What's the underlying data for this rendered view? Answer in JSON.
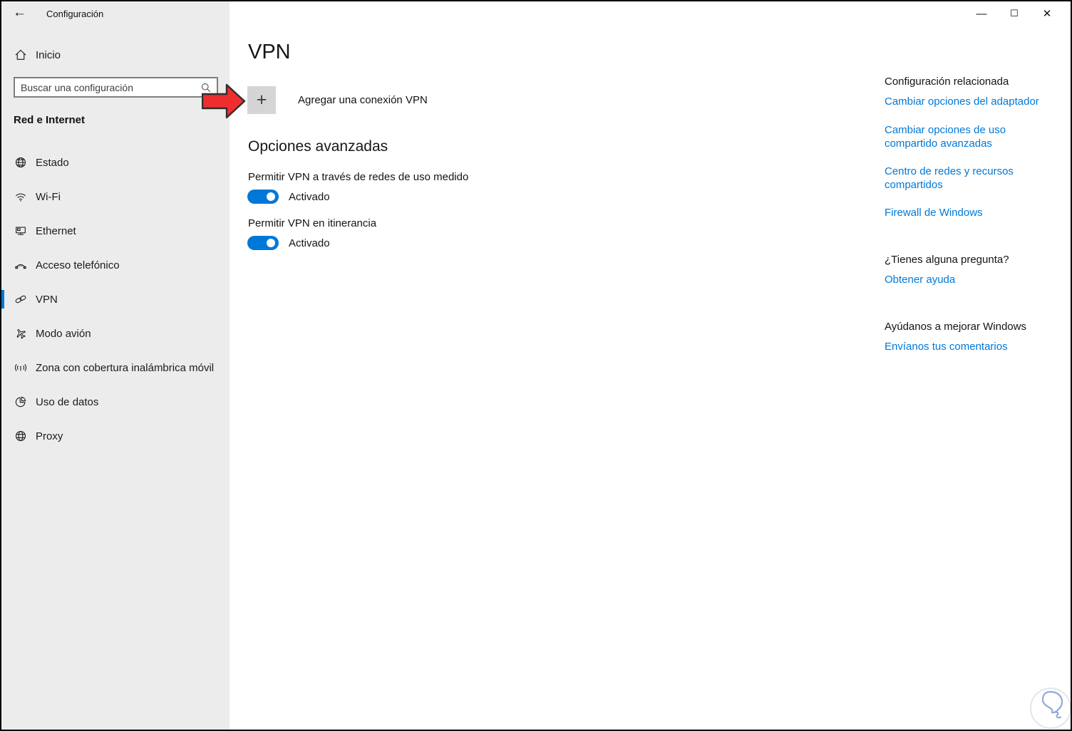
{
  "window": {
    "title": "Configuración",
    "back_glyph": "←",
    "controls": {
      "minimize": "—",
      "maximize": "☐",
      "close": "✕"
    }
  },
  "sidebar": {
    "home_label": "Inicio",
    "search_placeholder": "Buscar una configuración",
    "section_title": "Red e Internet",
    "items": [
      {
        "label": "Estado",
        "icon": "network-globe-icon",
        "selected": false
      },
      {
        "label": "Wi-Fi",
        "icon": "wifi-icon",
        "selected": false
      },
      {
        "label": "Ethernet",
        "icon": "ethernet-icon",
        "selected": false
      },
      {
        "label": "Acceso telefónico",
        "icon": "dialup-phone-icon",
        "selected": false
      },
      {
        "label": "VPN",
        "icon": "vpn-chain-icon",
        "selected": true
      },
      {
        "label": "Modo avión",
        "icon": "airplane-icon",
        "selected": false
      },
      {
        "label": "Zona con cobertura inalámbrica móvil",
        "icon": "mobile-hotspot-icon",
        "selected": false
      },
      {
        "label": "Uso de datos",
        "icon": "data-usage-pie-icon",
        "selected": false
      },
      {
        "label": "Proxy",
        "icon": "proxy-globe-icon",
        "selected": false
      }
    ]
  },
  "main": {
    "title": "VPN",
    "add_vpn": {
      "button_glyph": "+",
      "label": "Agregar una conexión VPN"
    },
    "advanced": {
      "heading": "Opciones avanzadas",
      "settings": [
        {
          "label": "Permitir VPN a través de redes de uso medido",
          "state": "Activado",
          "on": true
        },
        {
          "label": "Permitir VPN en itinerancia",
          "state": "Activado",
          "on": true
        }
      ]
    }
  },
  "related": {
    "heading": "Configuración relacionada",
    "links": [
      "Cambiar opciones del adaptador",
      "Cambiar opciones de uso compartido avanzadas",
      "Centro de redes y recursos compartidos",
      "Firewall de Windows"
    ]
  },
  "help": {
    "question_heading": "¿Tienes alguna pregunta?",
    "help_link": "Obtener ayuda",
    "feedback_heading": "Ayúdanos a mejorar Windows",
    "feedback_link": "Envíanos tus comentarios"
  },
  "colors": {
    "accent": "#0078d7",
    "link": "#0078d7",
    "sidebarBg": "#ececec",
    "arrowRed": "#ee2e2e"
  }
}
